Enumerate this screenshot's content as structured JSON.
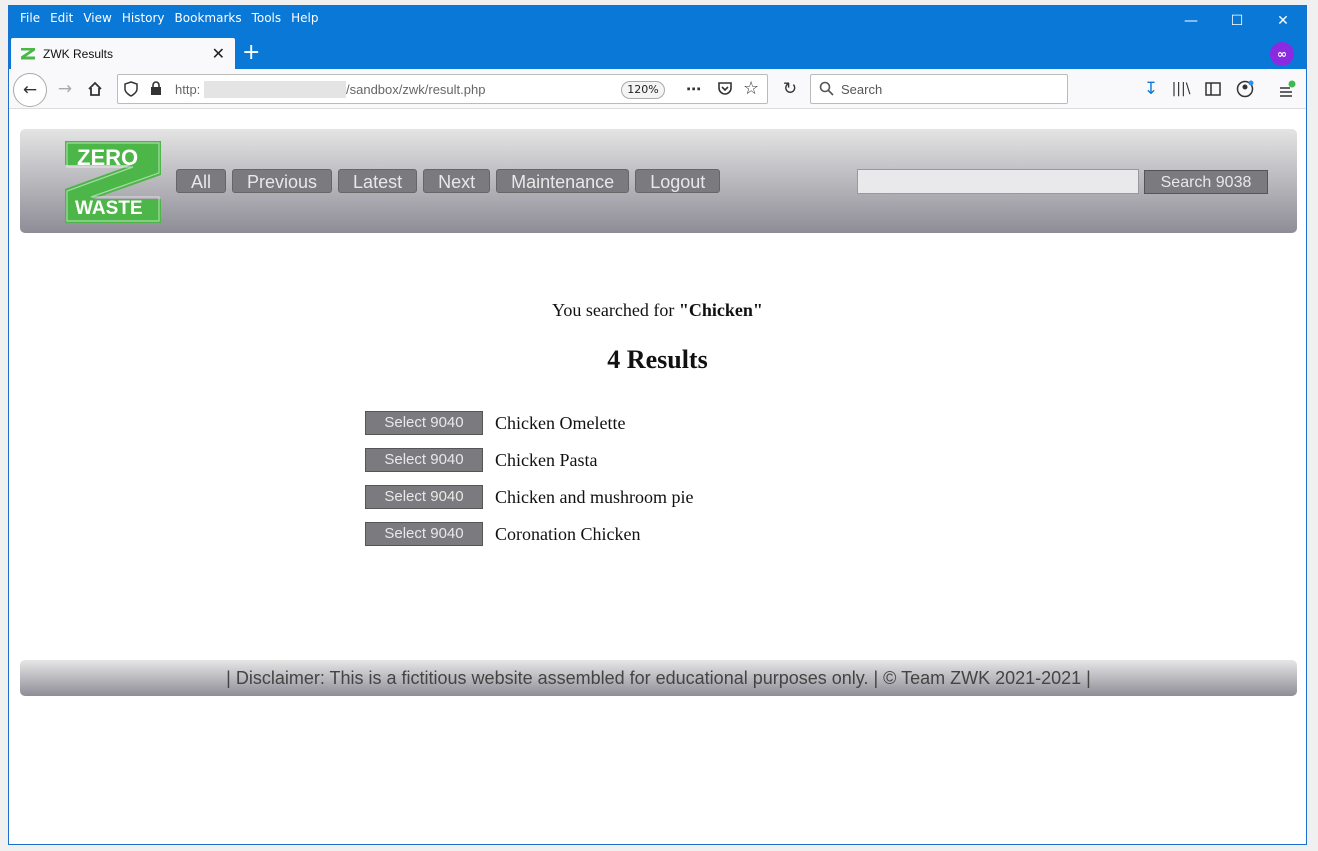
{
  "browser": {
    "menu": [
      "File",
      "Edit",
      "View",
      "History",
      "Bookmarks",
      "Tools",
      "Help"
    ],
    "tab_title": "ZWK Results",
    "url_prefix": "http:",
    "url_path": "/sandbox/zwk/result.php",
    "zoom": "120%",
    "search_placeholder": "Search"
  },
  "site": {
    "logo_top": "ZERO",
    "logo_bottom": "WASTE",
    "nav": [
      "All",
      "Previous",
      "Latest",
      "Next",
      "Maintenance",
      "Logout"
    ],
    "search_button": "Search 9038"
  },
  "results": {
    "searched_prefix": "You searched for ",
    "query": "\"Chicken\"",
    "count_title": "4 Results",
    "items": [
      {
        "button": "Select 9040",
        "name": "Chicken Omelette"
      },
      {
        "button": "Select 9040",
        "name": "Chicken Pasta"
      },
      {
        "button": "Select 9040",
        "name": "Chicken and mushroom pie"
      },
      {
        "button": "Select 9040",
        "name": "Coronation Chicken"
      }
    ]
  },
  "footer": {
    "text": "| Disclaimer: This is a fictitious website assembled for educational purposes only. | © Team ZWK 2021-2021 |"
  },
  "colors": {
    "titlebar": "#0a78d7",
    "button_gray": "#7b7b7f",
    "logo_green": "#4cb648"
  }
}
